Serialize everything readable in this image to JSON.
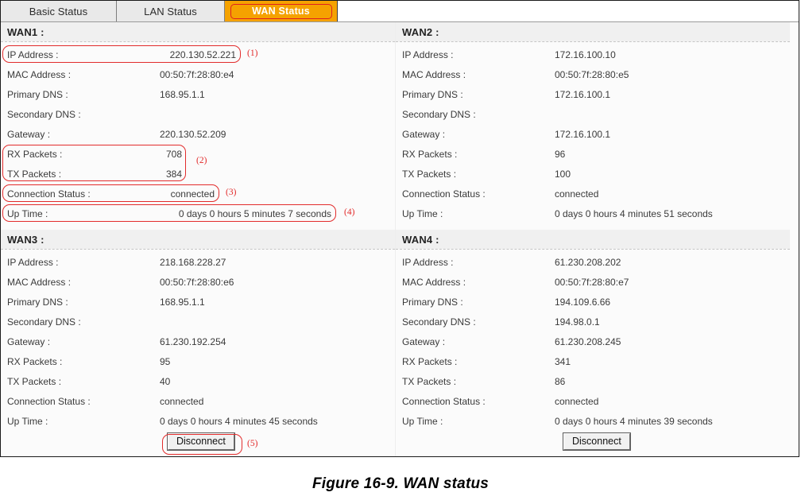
{
  "tabs": [
    {
      "label": "Basic Status",
      "active": false
    },
    {
      "label": "LAN Status",
      "active": false
    },
    {
      "label": "WAN Status",
      "active": true
    }
  ],
  "field_labels": {
    "ip": "IP Address :",
    "mac": "MAC Address :",
    "primary_dns": "Primary DNS :",
    "secondary_dns": "Secondary DNS :",
    "gateway": "Gateway :",
    "rx": "RX Packets :",
    "tx": "TX Packets :",
    "status": "Connection Status :",
    "uptime": "Up Time :"
  },
  "wan1": {
    "title": "WAN1 :",
    "ip": "220.130.52.221",
    "mac": "00:50:7f:28:80:e4",
    "primary_dns": "168.95.1.1",
    "secondary_dns": "",
    "gateway": "220.130.52.209",
    "rx": "708",
    "tx": "384",
    "status": "connected",
    "uptime": "0 days 0 hours 5 minutes 7 seconds"
  },
  "wan2": {
    "title": "WAN2 :",
    "ip": "172.16.100.10",
    "mac": "00:50:7f:28:80:e5",
    "primary_dns": "172.16.100.1",
    "secondary_dns": "",
    "gateway": "172.16.100.1",
    "rx": "96",
    "tx": "100",
    "status": "connected",
    "uptime": "0 days 0 hours 4 minutes 51 seconds"
  },
  "wan3": {
    "title": "WAN3 :",
    "ip": "218.168.228.27",
    "mac": "00:50:7f:28:80:e6",
    "primary_dns": "168.95.1.1",
    "secondary_dns": "",
    "gateway": "61.230.192.254",
    "rx": "95",
    "tx": "40",
    "status": "connected",
    "uptime": "0 days 0 hours 4 minutes 45 seconds",
    "button": "Disconnect"
  },
  "wan4": {
    "title": "WAN4 :",
    "ip": "61.230.208.202",
    "mac": "00:50:7f:28:80:e7",
    "primary_dns": "194.109.6.66",
    "secondary_dns": "194.98.0.1",
    "gateway": "61.230.208.245",
    "rx": "341",
    "tx": "86",
    "status": "connected",
    "uptime": "0 days 0 hours 4 minutes 39 seconds",
    "button": "Disconnect"
  },
  "annotations": [
    {
      "number": "(1)",
      "target": "wan1-ip-address"
    },
    {
      "number": "(2)",
      "target": "wan1-rx-tx-packets"
    },
    {
      "number": "(3)",
      "target": "wan1-connection-status"
    },
    {
      "number": "(4)",
      "target": "wan1-up-time"
    },
    {
      "number": "(5)",
      "target": "wan3-disconnect-button"
    }
  ],
  "caption": "Figure 16-9. WAN status",
  "colors": {
    "active_tab_bg": "#f5a200",
    "annotation_red": "#e22c2c",
    "header_bg": "#f0f0f0",
    "body_bg": "#fbfbfb"
  }
}
